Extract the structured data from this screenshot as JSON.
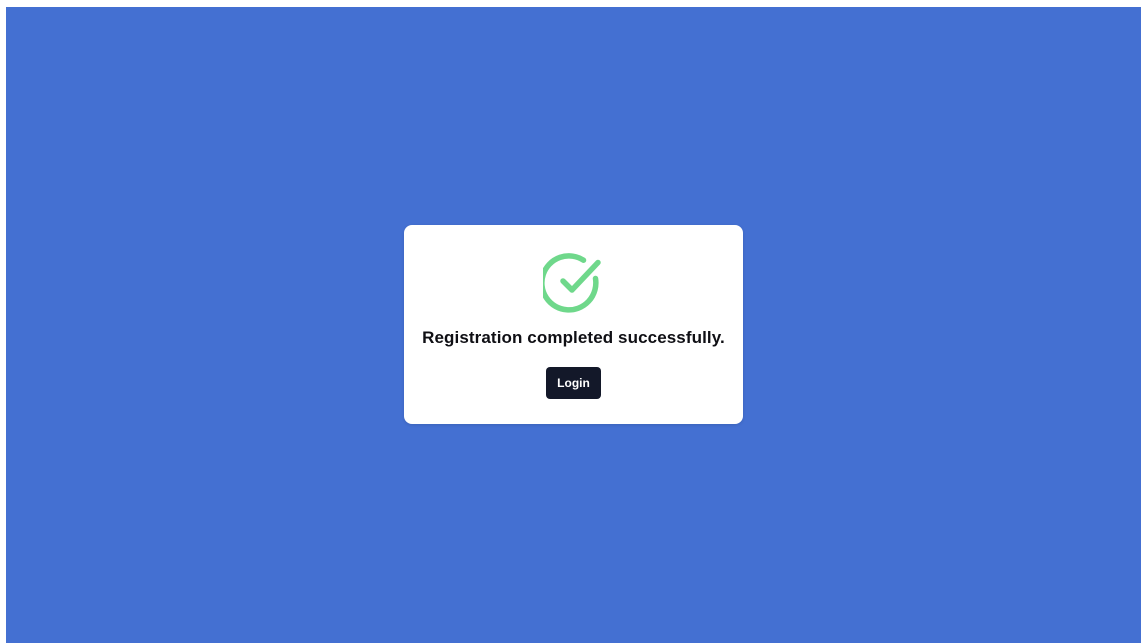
{
  "colors": {
    "page_background": "#4470d2",
    "card_background": "#ffffff",
    "success_icon": "#6fd88b",
    "button_background": "#131829",
    "button_text": "#ffffff",
    "message_text": "#0f0f14"
  },
  "dialog": {
    "icon": "check-circle-icon",
    "message": "Registration completed successfully.",
    "login_label": "Login"
  }
}
